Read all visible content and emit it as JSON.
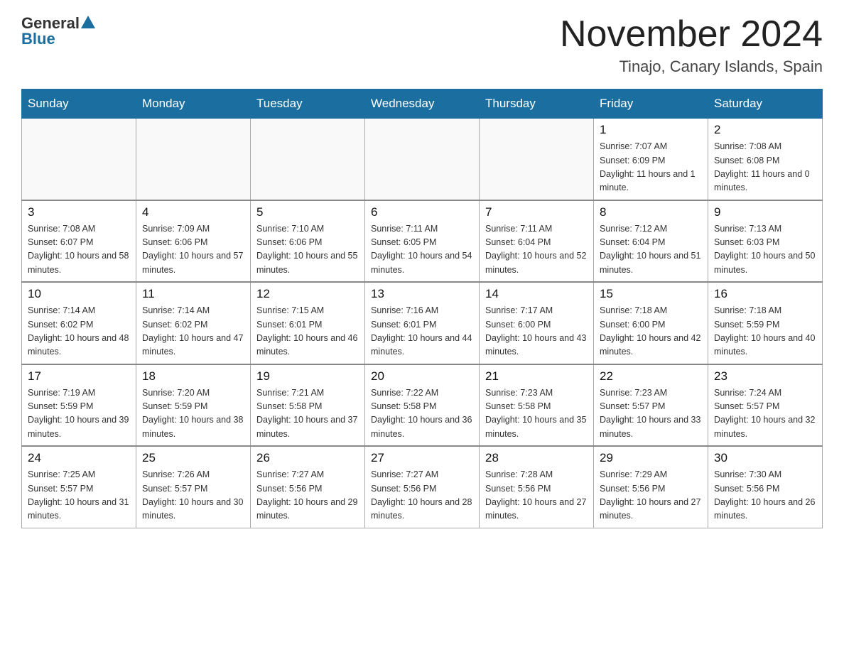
{
  "header": {
    "logo": {
      "general": "General",
      "blue": "Blue"
    },
    "title": "November 2024",
    "location": "Tinajo, Canary Islands, Spain"
  },
  "calendar": {
    "days_of_week": [
      "Sunday",
      "Monday",
      "Tuesday",
      "Wednesday",
      "Thursday",
      "Friday",
      "Saturday"
    ],
    "weeks": [
      [
        {
          "day": "",
          "info": ""
        },
        {
          "day": "",
          "info": ""
        },
        {
          "day": "",
          "info": ""
        },
        {
          "day": "",
          "info": ""
        },
        {
          "day": "",
          "info": ""
        },
        {
          "day": "1",
          "info": "Sunrise: 7:07 AM\nSunset: 6:09 PM\nDaylight: 11 hours and 1 minute."
        },
        {
          "day": "2",
          "info": "Sunrise: 7:08 AM\nSunset: 6:08 PM\nDaylight: 11 hours and 0 minutes."
        }
      ],
      [
        {
          "day": "3",
          "info": "Sunrise: 7:08 AM\nSunset: 6:07 PM\nDaylight: 10 hours and 58 minutes."
        },
        {
          "day": "4",
          "info": "Sunrise: 7:09 AM\nSunset: 6:06 PM\nDaylight: 10 hours and 57 minutes."
        },
        {
          "day": "5",
          "info": "Sunrise: 7:10 AM\nSunset: 6:06 PM\nDaylight: 10 hours and 55 minutes."
        },
        {
          "day": "6",
          "info": "Sunrise: 7:11 AM\nSunset: 6:05 PM\nDaylight: 10 hours and 54 minutes."
        },
        {
          "day": "7",
          "info": "Sunrise: 7:11 AM\nSunset: 6:04 PM\nDaylight: 10 hours and 52 minutes."
        },
        {
          "day": "8",
          "info": "Sunrise: 7:12 AM\nSunset: 6:04 PM\nDaylight: 10 hours and 51 minutes."
        },
        {
          "day": "9",
          "info": "Sunrise: 7:13 AM\nSunset: 6:03 PM\nDaylight: 10 hours and 50 minutes."
        }
      ],
      [
        {
          "day": "10",
          "info": "Sunrise: 7:14 AM\nSunset: 6:02 PM\nDaylight: 10 hours and 48 minutes."
        },
        {
          "day": "11",
          "info": "Sunrise: 7:14 AM\nSunset: 6:02 PM\nDaylight: 10 hours and 47 minutes."
        },
        {
          "day": "12",
          "info": "Sunrise: 7:15 AM\nSunset: 6:01 PM\nDaylight: 10 hours and 46 minutes."
        },
        {
          "day": "13",
          "info": "Sunrise: 7:16 AM\nSunset: 6:01 PM\nDaylight: 10 hours and 44 minutes."
        },
        {
          "day": "14",
          "info": "Sunrise: 7:17 AM\nSunset: 6:00 PM\nDaylight: 10 hours and 43 minutes."
        },
        {
          "day": "15",
          "info": "Sunrise: 7:18 AM\nSunset: 6:00 PM\nDaylight: 10 hours and 42 minutes."
        },
        {
          "day": "16",
          "info": "Sunrise: 7:18 AM\nSunset: 5:59 PM\nDaylight: 10 hours and 40 minutes."
        }
      ],
      [
        {
          "day": "17",
          "info": "Sunrise: 7:19 AM\nSunset: 5:59 PM\nDaylight: 10 hours and 39 minutes."
        },
        {
          "day": "18",
          "info": "Sunrise: 7:20 AM\nSunset: 5:59 PM\nDaylight: 10 hours and 38 minutes."
        },
        {
          "day": "19",
          "info": "Sunrise: 7:21 AM\nSunset: 5:58 PM\nDaylight: 10 hours and 37 minutes."
        },
        {
          "day": "20",
          "info": "Sunrise: 7:22 AM\nSunset: 5:58 PM\nDaylight: 10 hours and 36 minutes."
        },
        {
          "day": "21",
          "info": "Sunrise: 7:23 AM\nSunset: 5:58 PM\nDaylight: 10 hours and 35 minutes."
        },
        {
          "day": "22",
          "info": "Sunrise: 7:23 AM\nSunset: 5:57 PM\nDaylight: 10 hours and 33 minutes."
        },
        {
          "day": "23",
          "info": "Sunrise: 7:24 AM\nSunset: 5:57 PM\nDaylight: 10 hours and 32 minutes."
        }
      ],
      [
        {
          "day": "24",
          "info": "Sunrise: 7:25 AM\nSunset: 5:57 PM\nDaylight: 10 hours and 31 minutes."
        },
        {
          "day": "25",
          "info": "Sunrise: 7:26 AM\nSunset: 5:57 PM\nDaylight: 10 hours and 30 minutes."
        },
        {
          "day": "26",
          "info": "Sunrise: 7:27 AM\nSunset: 5:56 PM\nDaylight: 10 hours and 29 minutes."
        },
        {
          "day": "27",
          "info": "Sunrise: 7:27 AM\nSunset: 5:56 PM\nDaylight: 10 hours and 28 minutes."
        },
        {
          "day": "28",
          "info": "Sunrise: 7:28 AM\nSunset: 5:56 PM\nDaylight: 10 hours and 27 minutes."
        },
        {
          "day": "29",
          "info": "Sunrise: 7:29 AM\nSunset: 5:56 PM\nDaylight: 10 hours and 27 minutes."
        },
        {
          "day": "30",
          "info": "Sunrise: 7:30 AM\nSunset: 5:56 PM\nDaylight: 10 hours and 26 minutes."
        }
      ]
    ]
  }
}
